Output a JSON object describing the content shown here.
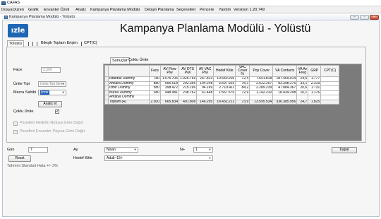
{
  "app": {
    "title": "CAFAS"
  },
  "menubar": {
    "items": [
      "Dosya",
      "Düzen",
      "Grafik",
      "Envanter Özeti",
      "Analiz",
      "Kampanya Planlama Modülü",
      "Detaylı Planlama",
      "Seçenekler",
      "Pencere",
      "Yardım",
      "Versiyon 1.20.749"
    ]
  },
  "window": {
    "title": "Kampanya Planlama Modülü - Yolüstü",
    "controls": {
      "minimize": "‒",
      "maximize": "▫",
      "close": "✕"
    }
  },
  "logo": {
    "text": "ızle"
  },
  "page_title": "Kampanya Planlama Modülü - Yolüstü",
  "top_tabs": [
    "Yolüstü",
    "Bileşik Toplam Erişim",
    "CPT(C)"
  ],
  "form": {
    "face_label": "Face",
    "face_value": "2.300",
    "unite_tipi_label": "Ünite Tipi",
    "unite_tipi_value": "Ünite Tipi Girin",
    "mecra_sahibi_label": "Mecra Sahibi",
    "mecra_sahibi_value": "Izmir",
    "analiz_button": "Analiz et",
    "coklu_unite_label": "Çoklu Ünite",
    "coklu_unite_checked": true,
    "check1_label": "Panelleri Hedefin Nüfusa Göre Dağıt",
    "check2_label": "Panelleri Envanter Payına Göre Dağıt"
  },
  "sub_tabs": [
    "Sonuçlar",
    "Çoklu Ünite"
  ],
  "grid": {
    "headers": [
      "",
      "Face",
      "AV Flow P/w",
      "AV DTS P/w",
      "AV VAC P/w",
      "Hedef Kitle",
      "VAC Cover %",
      "Pop Cover",
      "VA Contacts",
      "VA Av Freq",
      "GRP",
      "CPT(C)"
    ],
    "rows": [
      [
        "İstanbul Dummy",
        "780",
        "1.075.705",
        "1.025.769",
        "267.813",
        "10.540.206",
        "72,4",
        "7.641.818",
        "187.469.014",
        "24,5",
        "1.777",
        ""
      ],
      [
        "Ankara Dummy",
        "880",
        "555.618",
        "292.356",
        "104.248",
        "3.597.925",
        "78,1",
        "2.522.267",
        "83.398.276",
        "33,1",
        "2.319",
        ""
      ],
      [
        "İzmir Dummy",
        "580",
        "398.472",
        "215.196",
        "94.169",
        "2.719.411",
        "84,2",
        "2.289.239",
        "47.884.367",
        "20,6",
        "1.731",
        ""
      ],
      [
        "Bursa Dummy",
        "380",
        "448.981",
        "238.762",
        "61.448",
        "1.567.570",
        "72,9",
        "1.142.210",
        "18.434.298",
        "16,1",
        "1.176",
        ""
      ],
      [
        "Antalya Dummy",
        "",
        "",
        "",
        "",
        "",
        "",
        "",
        "",
        "",
        "",
        ""
      ]
    ],
    "total": [
      "Toplam (4)",
      "2.300",
      "665.834",
      "491.808",
      "146.295",
      "18.432.212",
      "73,9",
      "13.595.534",
      "336.385.956",
      "24,7",
      "1.825",
      ""
    ]
  },
  "bottom": {
    "gun_label": "Gün",
    "gun_value": "7",
    "ay_label": "Ay",
    "nisan_value": "Nisan",
    "n_label": "N+",
    "n_value": "1",
    "reset_button": "Reset",
    "hedef_kitle_label": "Hedef Kitle",
    "hedef_kitle_value": "Adult~15+",
    "kapat_button": "Kapat",
    "note": "Tahmini Standart Hata +/- 3%"
  }
}
